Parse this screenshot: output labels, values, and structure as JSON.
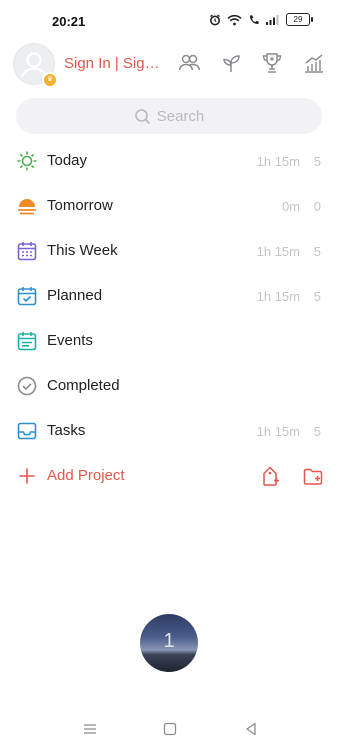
{
  "status_bar": {
    "time": "20:21",
    "battery": "29"
  },
  "header": {
    "sign_in": "Sign In | Sign..."
  },
  "search": {
    "placeholder": "Search"
  },
  "lists": [
    {
      "label": "Today",
      "duration": "1h 15m",
      "count": "5",
      "color": "#4caf50",
      "icon": "sun-icon"
    },
    {
      "label": "Tomorrow",
      "duration": "0m",
      "count": "0",
      "color": "#f08a24",
      "icon": "sunset-icon"
    },
    {
      "label": "This Week",
      "duration": "1h 15m",
      "count": "5",
      "color": "#7b61d9",
      "icon": "calendar-week-icon"
    },
    {
      "label": "Planned",
      "duration": "1h 15m",
      "count": "5",
      "color": "#2b8fd6",
      "icon": "calendar-check-icon"
    },
    {
      "label": "Events",
      "duration": "",
      "count": "",
      "color": "#1ab3a6",
      "icon": "calendar-events-icon"
    },
    {
      "label": "Completed",
      "duration": "",
      "count": "",
      "color": "#8c8c8c",
      "icon": "check-circle-icon"
    },
    {
      "label": "Tasks",
      "duration": "1h 15m",
      "count": "5",
      "color": "#2b8fd6",
      "icon": "inbox-icon"
    }
  ],
  "add_project": {
    "label": "Add Project",
    "color": "#e2574c"
  },
  "timer": {
    "value": "1"
  }
}
